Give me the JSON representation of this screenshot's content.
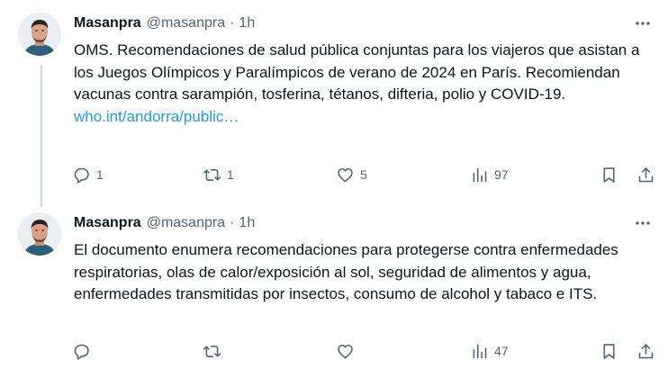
{
  "tweets": [
    {
      "author": {
        "display_name": "Masanpra",
        "handle": "@masanpra"
      },
      "separator": "·",
      "time": "1h",
      "text": "OMS. Recomendaciones de salud pública conjuntas para los viajeros que asistan a los Juegos Olímpicos y Paralímpicos de verano de 2024 en París. Recomiendan vacunas contra sarampión, tosferina, tétanos, difteria, polio y COVID-19.",
      "link": "who.int/andorra/public…",
      "stats": {
        "replies": "1",
        "reposts": "1",
        "likes": "5",
        "views": "97"
      }
    },
    {
      "author": {
        "display_name": "Masanpra",
        "handle": "@masanpra"
      },
      "separator": "·",
      "time": "1h",
      "text": "El documento enumera recomendaciones para protegerse contra enfermedades respiratorias, olas de calor/exposición al sol, seguridad de alimentos y agua, enfermedades transmitidas por insectos, consumo de alcohol y tabaco e ITS.",
      "stats": {
        "replies": "",
        "reposts": "",
        "likes": "",
        "views": "47"
      }
    }
  ],
  "icons": {
    "more": "more-horizontal-icon",
    "reply": "reply-icon",
    "repost": "repost-icon",
    "like": "heart-icon",
    "views": "views-bar-chart-icon",
    "bookmark": "bookmark-icon",
    "share": "share-icon"
  },
  "colors": {
    "text": "#0f1419",
    "secondary": "#536471",
    "link": "#1d9bf0",
    "thread_line": "#cfd9de"
  }
}
